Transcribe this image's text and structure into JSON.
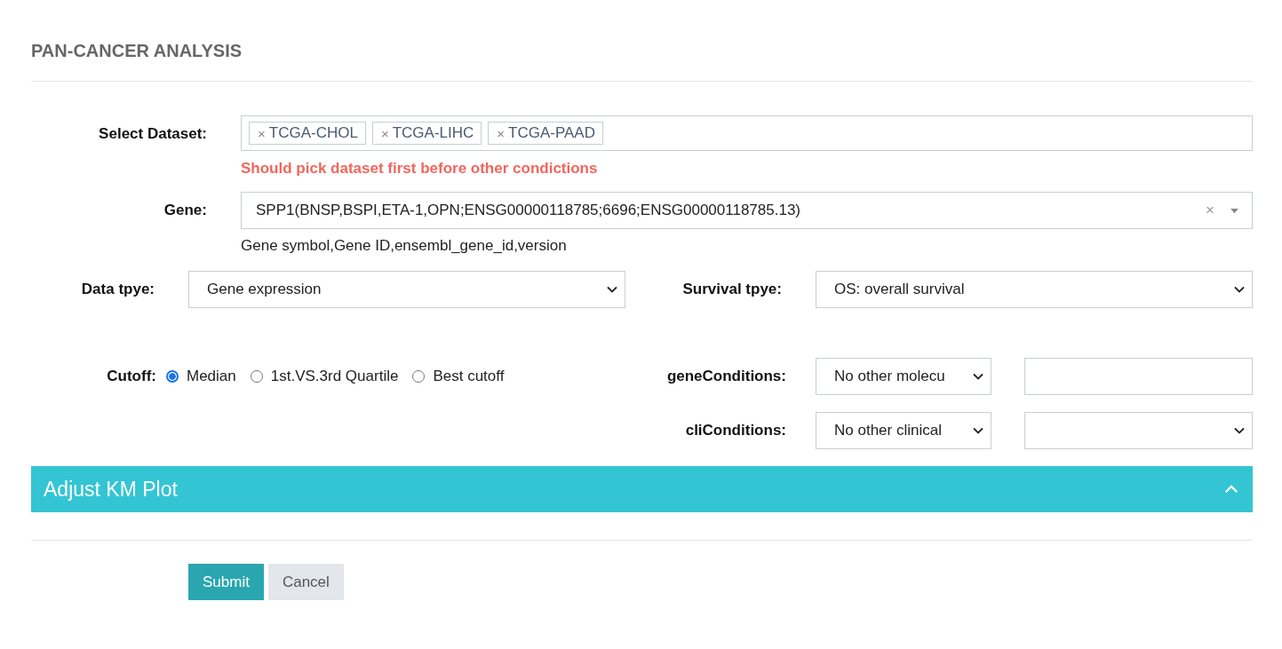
{
  "title": "PAN-CANCER ANALYSIS",
  "dataset": {
    "label": "Select Dataset:",
    "tags": [
      "TCGA-CHOL",
      "TCGA-LIHC",
      "TCGA-PAAD"
    ],
    "tag_remove": "×",
    "error": "Should pick dataset first before other condictions"
  },
  "gene": {
    "label": "Gene:",
    "value": "SPP1(BNSP,BSPI,ETA-1,OPN;ENSG00000118785;6696;ENSG00000118785.13)",
    "clear": "×",
    "help": "Gene symbol,Gene ID,ensembl_gene_id,version"
  },
  "data_type": {
    "label": "Data tpye:",
    "value": "Gene expression"
  },
  "survival_type": {
    "label": "Survival tpye:",
    "value": "OS: overall survival"
  },
  "cutoff": {
    "label": "Cutoff:",
    "options": [
      {
        "label": "Median",
        "selected": true
      },
      {
        "label": "1st.VS.3rd Quartile",
        "selected": false
      },
      {
        "label": "Best cutoff",
        "selected": false
      }
    ]
  },
  "conditions": [
    {
      "label": "geneConditions:",
      "select_value": "No other molecu",
      "kind": "input"
    },
    {
      "label": "cliConditions:",
      "select_value": "No other clinical",
      "kind": "select"
    }
  ],
  "panel": {
    "title": "Adjust KM Plot",
    "expanded": true
  },
  "buttons": [
    {
      "label": "Submit",
      "kind": "primary"
    },
    {
      "label": "Cancel",
      "kind": "secondary"
    }
  ]
}
